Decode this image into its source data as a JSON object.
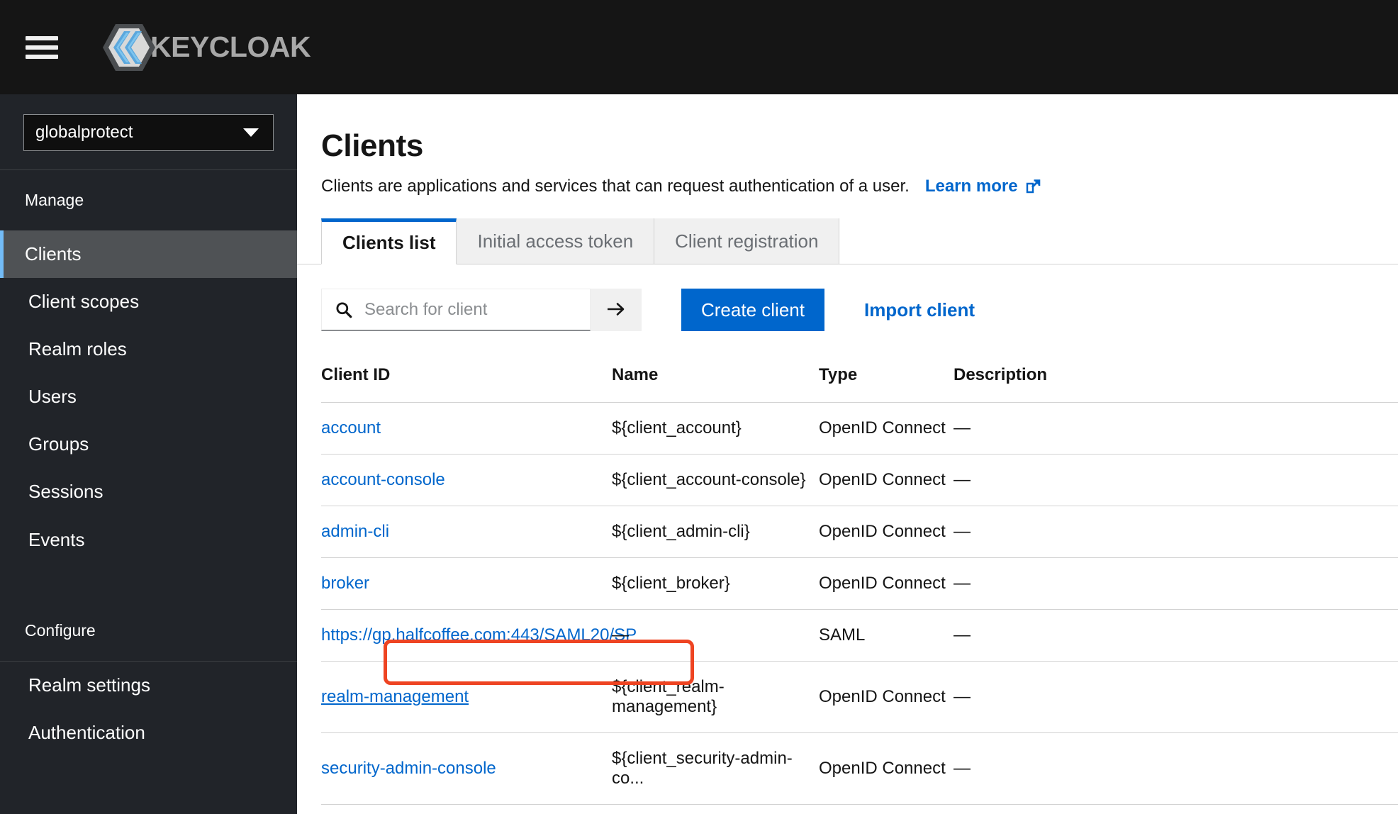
{
  "masthead": {
    "menu_toggle": "hamburger-menu",
    "brand": "KEYCLOAK",
    "brand_icon": "keycloak-logo"
  },
  "sidebar": {
    "realm_selector": {
      "value": "globalprotect",
      "caret_icon": "chevron-down-icon"
    },
    "sections": [
      {
        "title": "Manage",
        "items": [
          {
            "label": "Clients",
            "active": true
          },
          {
            "label": "Client scopes",
            "active": false
          },
          {
            "label": "Realm roles",
            "active": false
          },
          {
            "label": "Users",
            "active": false
          },
          {
            "label": "Groups",
            "active": false
          },
          {
            "label": "Sessions",
            "active": false
          },
          {
            "label": "Events",
            "active": false
          }
        ]
      },
      {
        "title": "Configure",
        "items": [
          {
            "label": "Realm settings",
            "active": false
          },
          {
            "label": "Authentication",
            "active": false
          }
        ]
      }
    ]
  },
  "page": {
    "title": "Clients",
    "description": "Clients are applications and services that can request authentication of a user.",
    "learn_more": "Learn more",
    "learn_more_icon": "external-link-icon"
  },
  "tabs": [
    {
      "label": "Clients list",
      "active": true
    },
    {
      "label": "Initial access token",
      "active": false
    },
    {
      "label": "Client registration",
      "active": false
    }
  ],
  "toolbar": {
    "search_placeholder": "Search for client",
    "search_value": "",
    "search_icon": "search-icon",
    "search_submit_icon": "arrow-right-icon",
    "create_label": "Create client",
    "import_label": "Import client"
  },
  "table": {
    "columns": [
      "Client ID",
      "Name",
      "Type",
      "Description"
    ],
    "rows": [
      {
        "client_id": "account",
        "name": "${client_account}",
        "type": "OpenID Connect",
        "description": "—",
        "highlighted": false,
        "hovered": false
      },
      {
        "client_id": "account-console",
        "name": "${client_account-console}",
        "type": "OpenID Connect",
        "description": "—",
        "highlighted": false,
        "hovered": false
      },
      {
        "client_id": "admin-cli",
        "name": "${client_admin-cli}",
        "type": "OpenID Connect",
        "description": "—",
        "highlighted": false,
        "hovered": false
      },
      {
        "client_id": "broker",
        "name": "${client_broker}",
        "type": "OpenID Connect",
        "description": "—",
        "highlighted": false,
        "hovered": false
      },
      {
        "client_id": "https://gp.halfcoffee.com:443/SAML20/SP",
        "name": "—",
        "type": "SAML",
        "description": "—",
        "highlighted": true,
        "hovered": false
      },
      {
        "client_id": "realm-management",
        "name": "${client_realm-management}",
        "type": "OpenID Connect",
        "description": "—",
        "highlighted": false,
        "hovered": true
      },
      {
        "client_id": "security-admin-console",
        "name": "${client_security-admin-co...",
        "type": "OpenID Connect",
        "description": "—",
        "highlighted": false,
        "hovered": false
      }
    ]
  },
  "colors": {
    "masthead_bg": "#151515",
    "sidebar_bg": "#212429",
    "nav_active_bg": "#4f5255",
    "nav_active_accent": "#73bcf7",
    "link_blue": "#0066cc",
    "primary_button": "#0066cc",
    "annotation_red": "#ee4422",
    "brand_text": "#a8a8a8"
  }
}
